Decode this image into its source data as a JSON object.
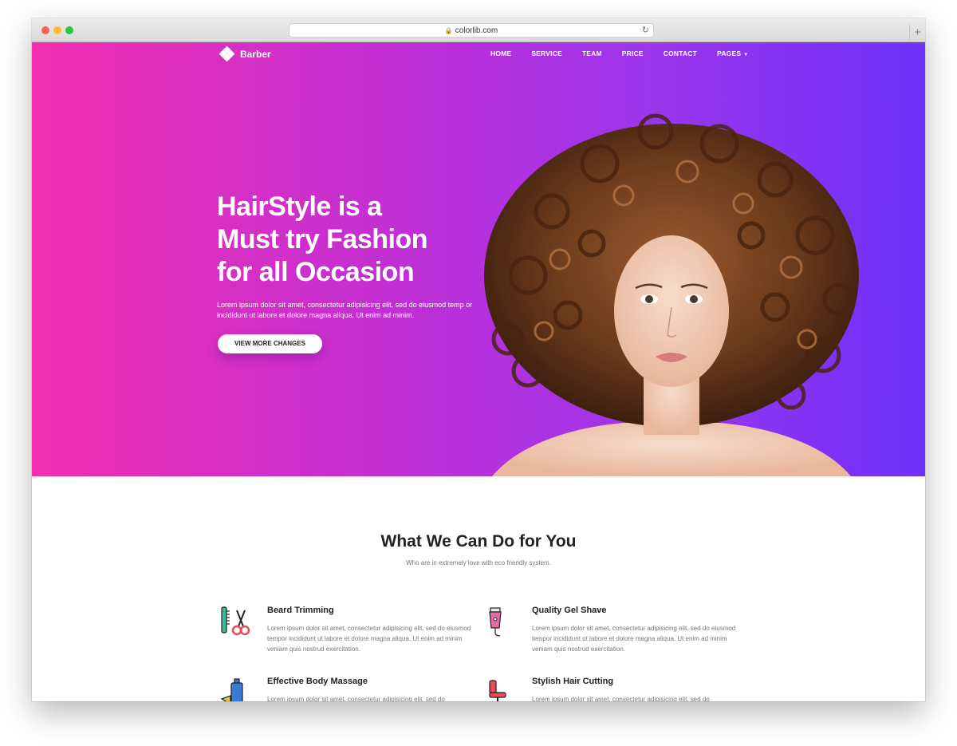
{
  "browser": {
    "url": "colorlib.com"
  },
  "site": {
    "brand": "Barber",
    "nav": [
      "HOME",
      "SERVICE",
      "TEAM",
      "PRICE",
      "CONTACT",
      "PAGES"
    ]
  },
  "hero": {
    "headline": [
      "HairStyle is a",
      "Must try Fashion",
      "for all Occasion"
    ],
    "lead": "Lorem ipsum dolor sit amet, consectetur adipisicing elit, sed do eiusmod temp or incididunt ut labore et dolore magna aliqua. Ut enim ad minim.",
    "button": "VIEW MORE CHANGES"
  },
  "services": {
    "title": "What We Can Do for You",
    "subtitle": "Who are in extremely love with eco friendly system.",
    "items": [
      {
        "title": "Beard Trimming",
        "text": "Lorem ipsum dolor sit amet, consectetur adipisicing elit, sed do eiusmod tempor incididunt ut labore et dolore magna aliqua. Ut enim ad minim veniam quis nostrud exercitation.",
        "icon": "comb-scissors-icon"
      },
      {
        "title": "Quality Gel Shave",
        "text": "Lorem ipsum dolor sit amet, consectetur adipisicing elit, sed do eiusmod tempor incididunt ut labore et dolore magna aliqua. Ut enim ad minim veniam quis nostrud exercitation.",
        "icon": "clipper-icon"
      },
      {
        "title": "Effective Body Massage",
        "text": "Lorem ipsum dolor sit amet, consectetur adipisicing elit, sed do",
        "icon": "spray-bottle-icon"
      },
      {
        "title": "Stylish Hair Cutting",
        "text": "Lorem ipsum dolor sit amet, consectetur adipisicing elit, sed do",
        "icon": "barber-chair-icon"
      }
    ]
  },
  "colors": {
    "gradient_start": "#f22fb0",
    "gradient_end": "#6e31fa"
  }
}
